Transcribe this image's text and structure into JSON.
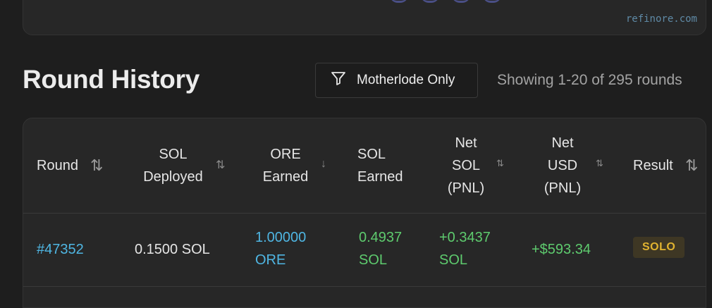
{
  "brand": "refinore.com",
  "section_title": "Round History",
  "filter": {
    "label": "Motherlode Only",
    "icon": "filter-icon"
  },
  "pagination": {
    "showing": "Showing 1-20 of 295 rounds"
  },
  "table": {
    "columns": [
      {
        "line1": "Round",
        "line2": "",
        "line3": "",
        "sort": "⇅"
      },
      {
        "line1": "SOL",
        "line2": "Deployed",
        "line3": "",
        "sort": "⇅"
      },
      {
        "line1": "ORE",
        "line2": "Earned",
        "line3": "",
        "sort": "↓"
      },
      {
        "line1": "SOL",
        "line2": "Earned",
        "line3": "",
        "sort": ""
      },
      {
        "line1": "Net",
        "line2": "SOL",
        "line3": "(PNL)",
        "sort": "⇅"
      },
      {
        "line1": "Net",
        "line2": "USD",
        "line3": "(PNL)",
        "sort": "⇅"
      },
      {
        "line1": "Result",
        "line2": "",
        "line3": "",
        "sort": "⇅"
      }
    ],
    "rows": [
      {
        "round": "#47352",
        "sol_deployed": "0.1500 SOL",
        "ore_earned_1": "1.00000",
        "ore_earned_2": "ORE",
        "sol_earned_1": "0.4937",
        "sol_earned_2": "SOL",
        "net_sol_1": "+0.3437",
        "net_sol_2": "SOL",
        "net_usd": "+$593.34",
        "result": "SOLO"
      }
    ]
  },
  "colors": {
    "accent_blue": "#4fb6e3",
    "positive_green": "#5ecb6e",
    "badge_gold": "#e0b330"
  }
}
